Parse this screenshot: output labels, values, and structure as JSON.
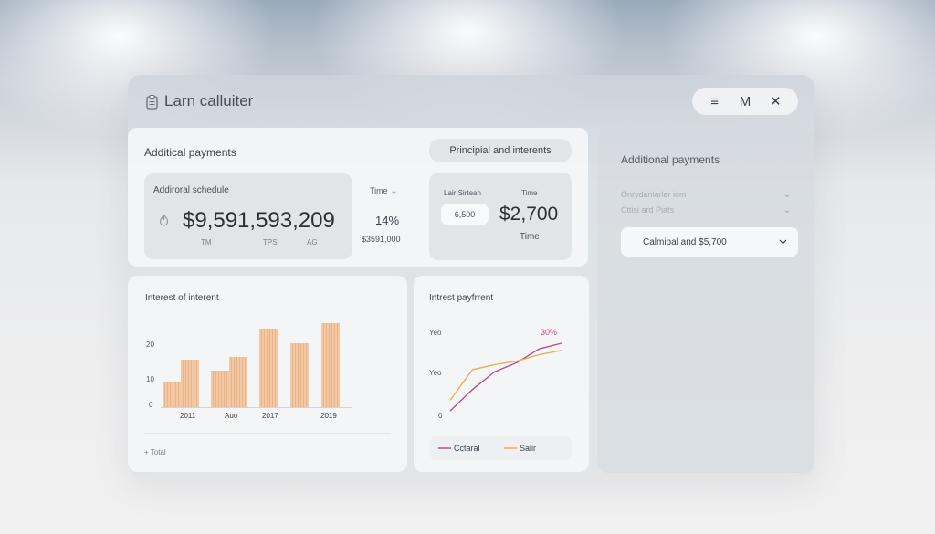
{
  "app": {
    "title": "Larn calluiter"
  },
  "window_controls": {
    "menu": "≡",
    "maximize": "M",
    "close": "✕"
  },
  "top_left_card": {
    "title": "Additical payments",
    "schedule_box": {
      "label": "Addiroral schedule",
      "amount": "$9,591,593,209",
      "footer_a": "TM",
      "footer_b": "TPS",
      "footer_c": "AG"
    },
    "time_select": "Time",
    "percent": "14%",
    "sub_amount": "$3591,000"
  },
  "principal_card": {
    "button_label": "Principial and interents",
    "col1_label": "Lair Sirtean",
    "col2_label": "Time",
    "input_value": "6,500",
    "amount": "$2,700",
    "amount_caption": "Time"
  },
  "side_panel": {
    "title": "Additional payments",
    "row1": "Onrydanlarler iom",
    "row2": "Cttisi ard Piats",
    "select_value": "Calmipal and $5,700"
  },
  "bar_chart_card": {
    "title": "Interest of interent",
    "total_label": "Total"
  },
  "line_chart_card": {
    "title": "Intrest payfrrent"
  },
  "chart_data": [
    {
      "type": "bar",
      "title": "Interest of interent",
      "x_tick_labels": [
        "2011",
        "Auo",
        "2017",
        "2019"
      ],
      "y_tick_labels": [
        "20",
        "10",
        "0"
      ],
      "categories": [
        "1",
        "2",
        "3",
        "4",
        "5",
        "6",
        "7"
      ],
      "values": [
        9,
        17,
        13,
        18,
        28,
        23,
        30
      ],
      "ylim": [
        0,
        32
      ],
      "colors": {
        "bar": "#efc39d"
      }
    },
    {
      "type": "line",
      "title": "Intrest payfrrent",
      "y_tick_labels": [
        "Yeo",
        "Yeo",
        "0"
      ],
      "annotation": "30%",
      "x": [
        0,
        1,
        2,
        3,
        4,
        5
      ],
      "ylim": [
        0,
        100
      ],
      "series": [
        {
          "name": "Cctaral",
          "color": "#b4508c",
          "values": [
            5,
            35,
            60,
            73,
            92,
            100
          ]
        },
        {
          "name": "Salir",
          "color": "#e8b04f",
          "values": [
            20,
            63,
            70,
            75,
            84,
            90
          ]
        }
      ]
    }
  ]
}
